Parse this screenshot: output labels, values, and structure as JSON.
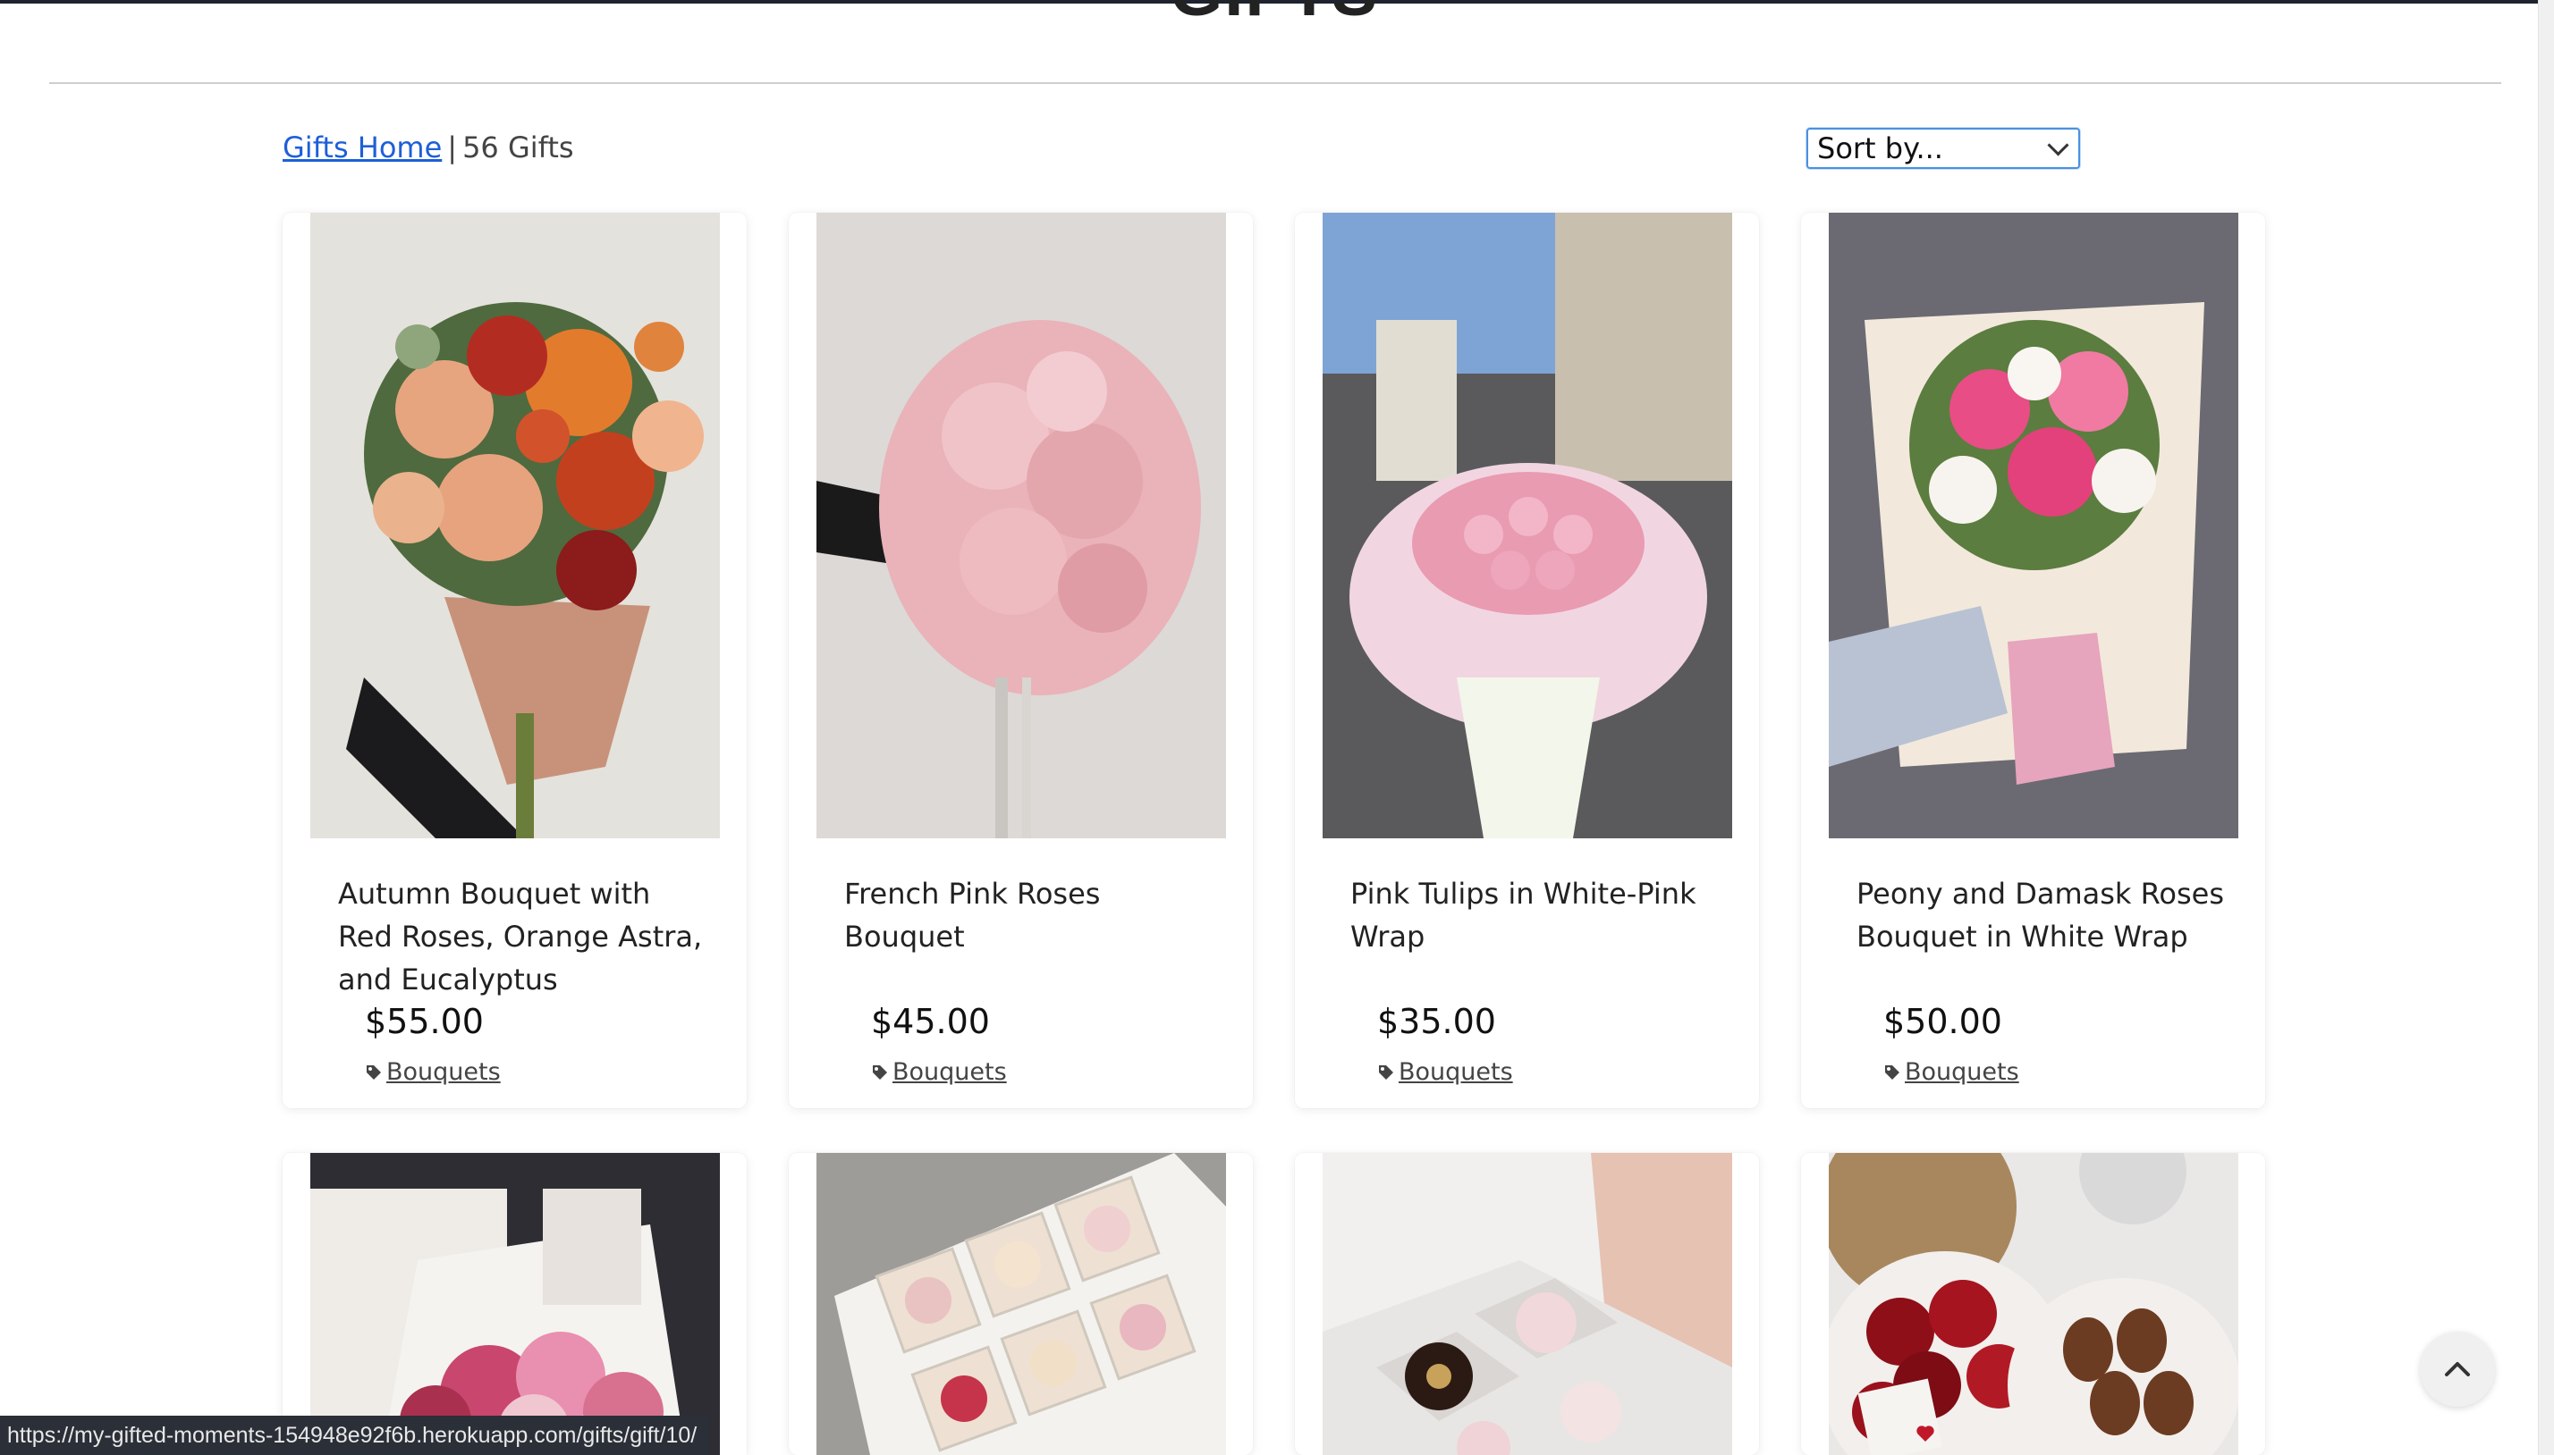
{
  "page": {
    "title": "GIFTS"
  },
  "breadcrumb": {
    "home_label": "Gifts Home",
    "separator": "|",
    "count_label": "56 Gifts"
  },
  "sort": {
    "selected": "Sort by..."
  },
  "products": [
    {
      "name": "Autumn Bouquet with Red Roses, Orange Astra, and Eucalyptus",
      "price": "$55.00",
      "category": "Bouquets"
    },
    {
      "name": "French Pink Roses Bouquet",
      "price": "$45.00",
      "category": "Bouquets"
    },
    {
      "name": "Pink Tulips in White-Pink Wrap",
      "price": "$35.00",
      "category": "Bouquets"
    },
    {
      "name": "Peony and Damask Roses Bouquet in White Wrap",
      "price": "$50.00",
      "category": "Bouquets"
    }
  ],
  "status_bar": {
    "url": "https://my-gifted-moments-154948e92f6b.herokuapp.com/gifts/gift/10/"
  },
  "colors": {
    "link": "#1e5fd8",
    "status_bg": "#2b2f38",
    "select_border": "#4a90e2"
  },
  "icons": {
    "tag": "tag-icon",
    "scroll_top": "chevron-up-icon",
    "sort": "chevron-down-icon"
  }
}
